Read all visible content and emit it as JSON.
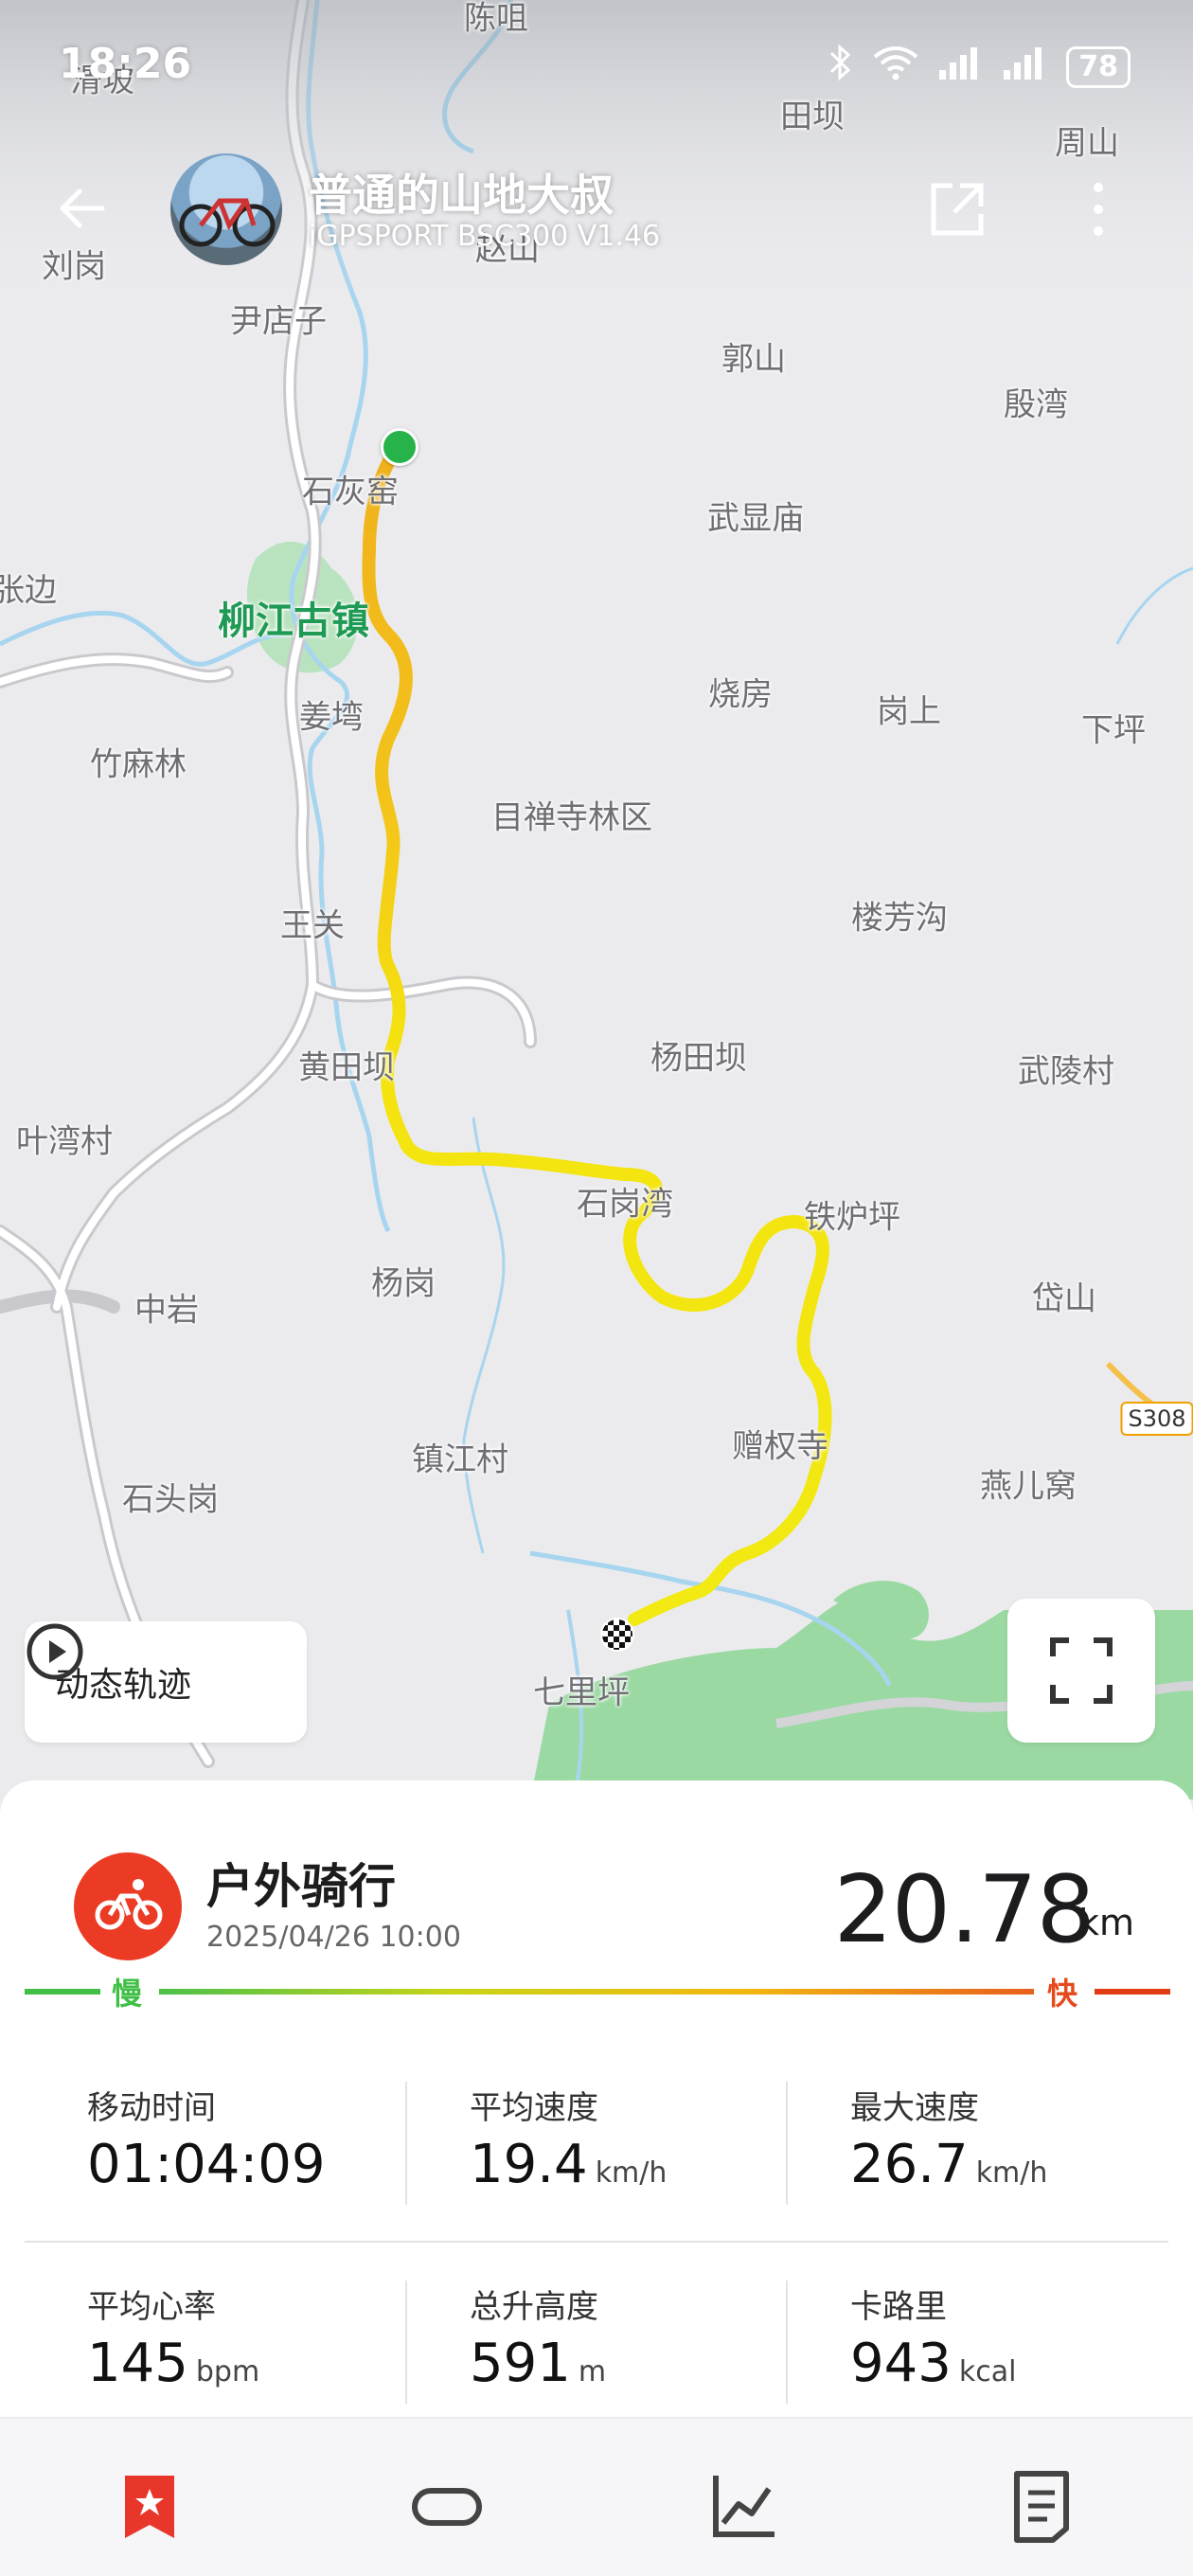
{
  "status_bar": {
    "time": "18:26",
    "battery": "78"
  },
  "header": {
    "user_name": "普通的山地大叔",
    "device": "iGPSPORT BSC300  V1.46"
  },
  "map": {
    "places": [
      {
        "id": "chenzui",
        "text": "陈咀"
      },
      {
        "id": "huapo",
        "text": "滑坡"
      },
      {
        "id": "tianba",
        "text": "田坝"
      },
      {
        "id": "zhoushan",
        "text": "周山"
      },
      {
        "id": "liugang",
        "text": "刘岗"
      },
      {
        "id": "zhaoshan",
        "text": "赵山"
      },
      {
        "id": "yindianzi",
        "text": "尹店子"
      },
      {
        "id": "guoshan",
        "text": "郭山"
      },
      {
        "id": "yinwan",
        "text": "殷湾"
      },
      {
        "id": "shihuiyao",
        "text": "石灰窑"
      },
      {
        "id": "wuxianmiao",
        "text": "武显庙"
      },
      {
        "id": "zhangbian",
        "text": "张边"
      },
      {
        "id": "liujiang",
        "text": "柳江古镇"
      },
      {
        "id": "jiangwan",
        "text": "姜塆"
      },
      {
        "id": "shaofang",
        "text": "烧房"
      },
      {
        "id": "gangshang",
        "text": "岗上"
      },
      {
        "id": "xiaping",
        "text": "下坪"
      },
      {
        "id": "zhumalin",
        "text": "竹麻林"
      },
      {
        "id": "mushansi",
        "text": "目禅寺林区"
      },
      {
        "id": "loufanggou",
        "text": "楼芳沟"
      },
      {
        "id": "wangguan",
        "text": "王关"
      },
      {
        "id": "yangtianba",
        "text": "杨田坝"
      },
      {
        "id": "wulingcun",
        "text": "武陵村"
      },
      {
        "id": "huangtianba",
        "text": "黄田坝"
      },
      {
        "id": "yewancun",
        "text": "叶湾村"
      },
      {
        "id": "shigangwan",
        "text": "石岗湾"
      },
      {
        "id": "tieluping",
        "text": "铁炉坪"
      },
      {
        "id": "yanggang",
        "text": "杨岗"
      },
      {
        "id": "zhongyan",
        "text": "中岩"
      },
      {
        "id": "daishan",
        "text": "岱山"
      },
      {
        "id": "zengquansi",
        "text": "赠权寺"
      },
      {
        "id": "zhenjiangcun",
        "text": "镇江村"
      },
      {
        "id": "shitougang",
        "text": "石头岗"
      },
      {
        "id": "yanerwo",
        "text": "燕儿窝"
      },
      {
        "id": "qiliping",
        "text": "七里坪"
      }
    ],
    "road_shield": "S308",
    "replay_label": "动态轨迹"
  },
  "activity": {
    "type": "户外骑行",
    "datetime": "2025/04/26 10:00",
    "distance": "20.78",
    "distance_unit": "km",
    "scale_slow": "慢",
    "scale_fast": "快",
    "accent_color": "#ec3b24"
  },
  "stats": [
    {
      "label": "移动时间",
      "value": "01:04:09",
      "unit": ""
    },
    {
      "label": "平均速度",
      "value": "19.4",
      "unit": "km/h"
    },
    {
      "label": "最大速度",
      "value": "26.7",
      "unit": "km/h"
    },
    {
      "label": "平均心率",
      "value": "145",
      "unit": "bpm"
    },
    {
      "label": "总升高度",
      "value": "591",
      "unit": "m"
    },
    {
      "label": "卡路里",
      "value": "943",
      "unit": "kcal"
    }
  ],
  "bottom_nav": [
    {
      "icon": "star-bookmark-icon",
      "active": true
    },
    {
      "icon": "loop-icon",
      "active": false
    },
    {
      "icon": "chart-icon",
      "active": false
    },
    {
      "icon": "document-icon",
      "active": false
    }
  ]
}
